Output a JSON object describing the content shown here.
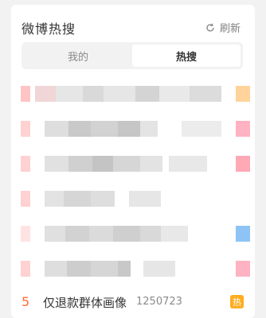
{
  "header": {
    "title": "微博热搜",
    "refresh_label": "刷新"
  },
  "tabs": [
    {
      "label": "我的",
      "active": false
    },
    {
      "label": "热搜",
      "active": true
    }
  ],
  "colors": {
    "accent_rank": "#ff6b38",
    "hot_badge": "#ffac1f",
    "blur_light": "#e9e9e9",
    "blur_mid": "#d4d4d4",
    "blur_dark": "#c2c2c2"
  },
  "hidden_rows": [
    {
      "rank_color": "#ffc4c4",
      "badge_color": "#ffd39a"
    },
    {
      "rank_color": "#ffd1d1",
      "badge_color": "#ffb2c2"
    },
    {
      "rank_color": "#ffd1d1",
      "badge_color": "#ffa9b7"
    },
    {
      "rank_color": "#ffd1d1",
      "badge_color": ""
    },
    {
      "rank_color": "#ffe3e3",
      "badge_color": "#8ec4f5"
    },
    {
      "rank_color": "#ffd1d1",
      "badge_color": "#ffb2c2"
    }
  ],
  "last_row": {
    "rank": "5",
    "topic": "仅退款群体画像",
    "count": "1250723",
    "badge": "热"
  }
}
